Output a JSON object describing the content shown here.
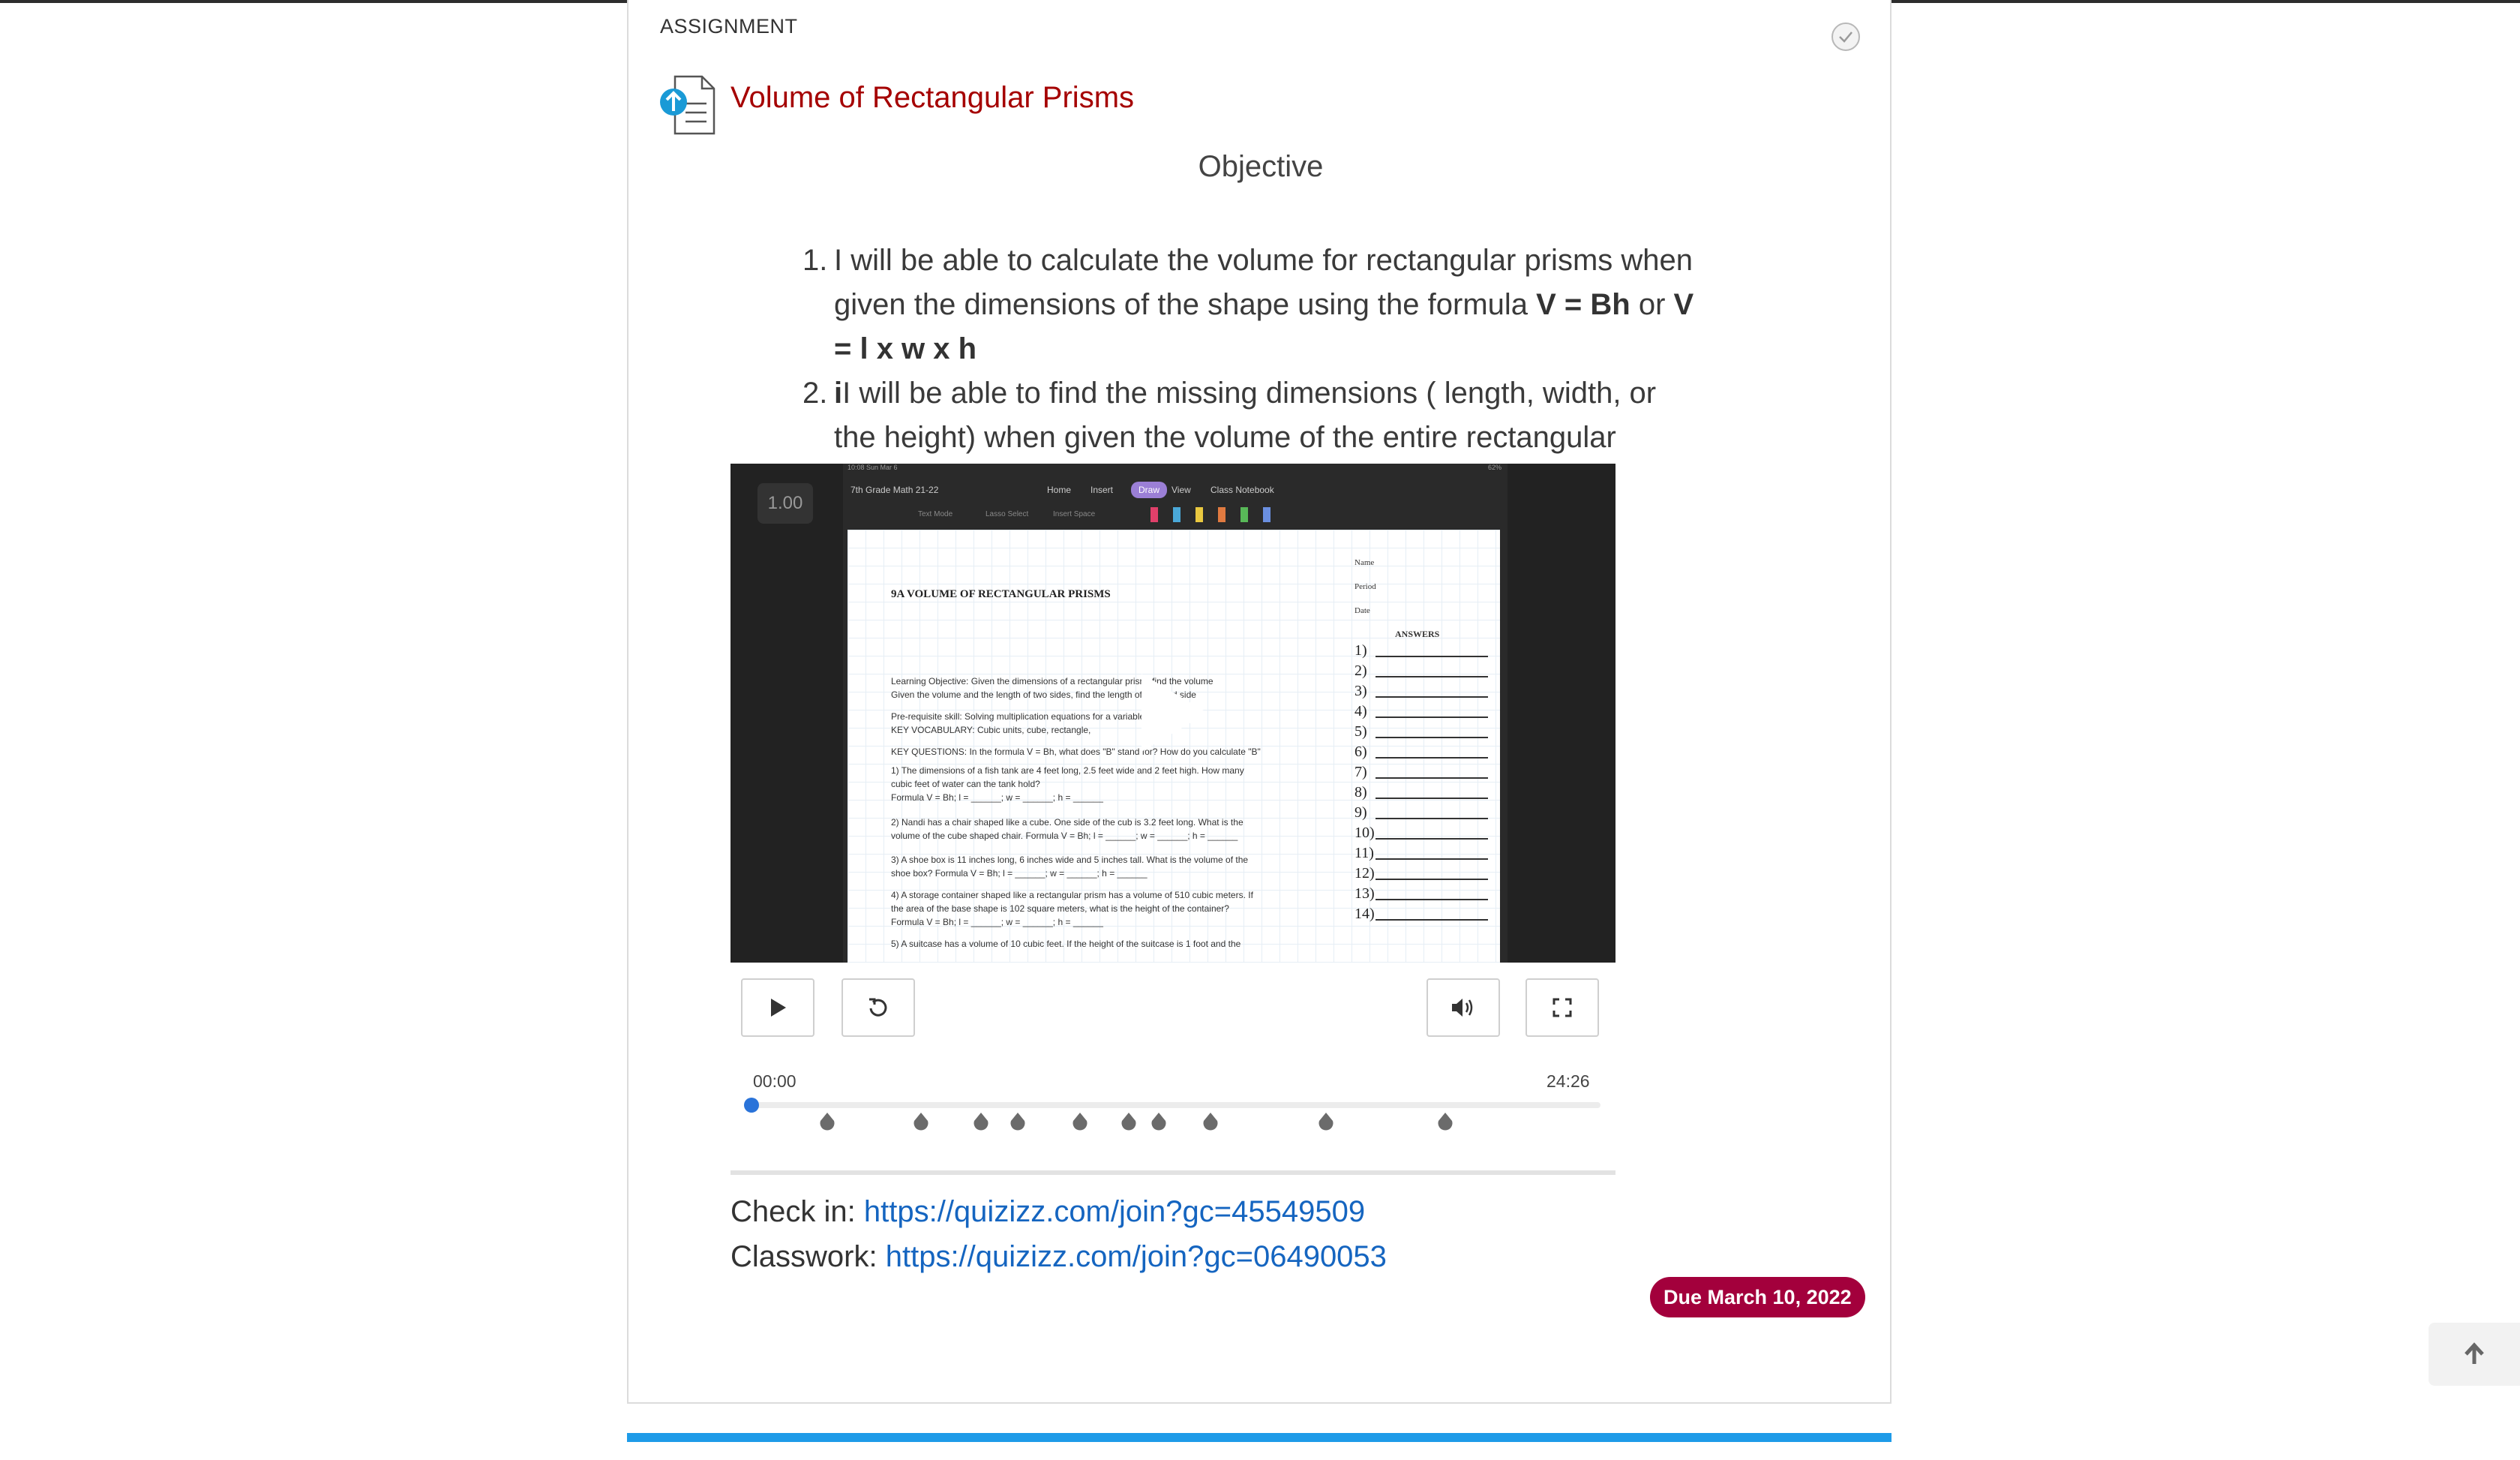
{
  "assignment": {
    "label": "ASSIGNMENT",
    "title": "Volume of Rectangular Prisms",
    "heading": "Objective",
    "objectives": [
      {
        "num": "1.",
        "text_a": "I will be able to calculate the volume for rectangular prisms when given the dimensions of the shape using the formula ",
        "formula1": "V = Bh",
        "or": " or ",
        "formula2": "V = l x w x h"
      },
      {
        "num": "2.",
        "lead": "i",
        "text": "I will be able to find the missing dimensions ( length, width, or the height) when given the volume of the entire rectangular prism."
      }
    ],
    "check_in_label": "Check in:",
    "check_in_url": "https://quizizz.com/join?gc=45549509",
    "classwork_label": "Classwork:",
    "classwork_url": "https://quizizz.com/join?gc=06490053",
    "due": "Due March 10, 2022"
  },
  "video": {
    "speed": "1.00",
    "current_time": "00:00",
    "duration": "24:26",
    "progress": 0,
    "frame": {
      "status_left": "10:08  Sun Mar 6",
      "status_right": "62%",
      "notebook": "7th Grade Math 21-22",
      "menu": [
        "Home",
        "Insert",
        "Draw",
        "View",
        "Class Notebook"
      ],
      "tools": [
        "Text Mode",
        "Lasso Select",
        "Insert Space"
      ],
      "worksheet_title": "9A VOLUME OF RECTANGULAR PRISMS",
      "worksheet_lines": [
        "Learning Objective: Given the dimensions of a rectangular prism, find the volume",
        "Given the volume and the length of two sides, find the length of the third side",
        "Pre-requisite skill: Solving multiplication equations for a variable. W = XYZ",
        "KEY VOCABULARY: Cubic units, cube, rectangle,",
        "KEY QUESTIONS: In the formula V = Bh, what does \"B\" stand for? How do you calculate \"B\"",
        "1) The dimensions of a fish tank are 4 feet long, 2.5 feet wide and 2 feet high. How many",
        "cubic feet of water can the tank hold?",
        "Formula V = Bh; l = ______; w = ______; h = ______",
        "2) Nandi has a chair shaped like a cube. One side of the cub is 3.2 feet long. What is the",
        "volume of the cube shaped chair. Formula V = Bh; l = ______; w = ______; h = ______",
        "3) A shoe box is 11 inches long, 6 inches wide and 5 inches tall. What is the volume of the",
        "shoe box? Formula V = Bh; l = ______; w = ______; h = ______",
        "4) A storage container shaped like a rectangular prism has a volume of 510 cubic meters. If",
        "the area of the base shape is 102 square meters, what is the height of the container?",
        "Formula V = Bh; l = ______; w = ______; h = ______",
        "5) A suitcase has a volume of 10 cubic feet. If the height of the suitcase is 1 foot and the"
      ],
      "name_fields": [
        "Name",
        "Period",
        "Date"
      ],
      "answers_label": "ANSWERS",
      "answer_numbers": [
        "1)",
        "2)",
        "3)",
        "4)",
        "5)",
        "6)",
        "7)",
        "8)",
        "9)",
        "10)",
        "11)",
        "12)",
        "13)",
        "14)"
      ]
    },
    "markers": [
      0.089,
      0.2,
      0.27,
      0.314,
      0.387,
      0.444,
      0.48,
      0.541,
      0.677,
      0.817
    ]
  },
  "icons": {
    "check": "check-circle-icon",
    "doc": "document-upload-icon",
    "play": "play-icon",
    "replay": "replay-icon",
    "volume": "volume-icon",
    "fullscreen": "fullscreen-icon",
    "scroll_top": "arrow-up-icon"
  },
  "colors": {
    "title": "#a50000",
    "link": "#1565c0",
    "due_badge": "#a3003c",
    "progress_knob": "#2a73d9",
    "bottom_bar": "#1e9be8"
  }
}
